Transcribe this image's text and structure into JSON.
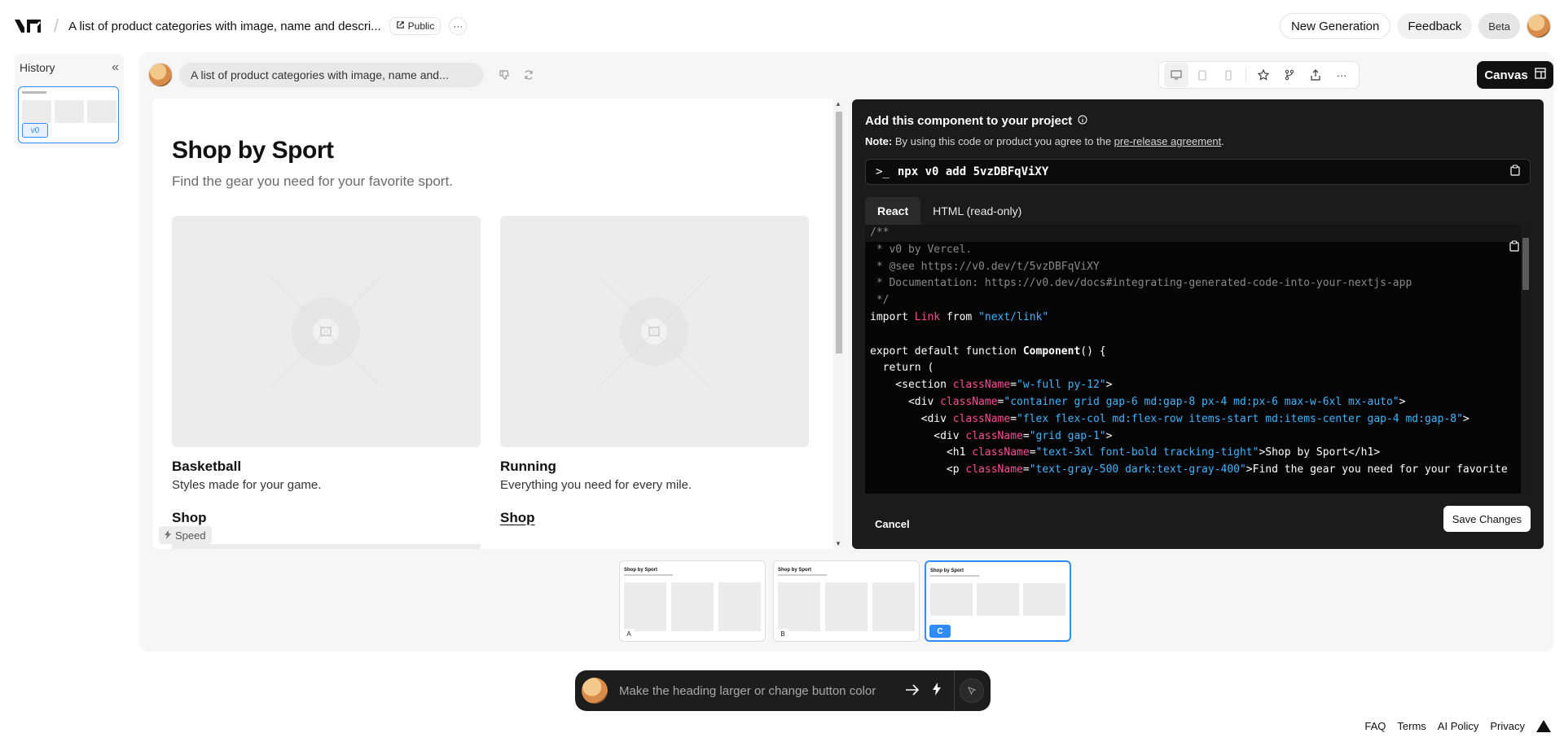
{
  "header": {
    "logo_text": "v0",
    "title": "A list of product categories with image, name and descri...",
    "visibility": "Public",
    "more": "···",
    "new_generation": "New Generation",
    "feedback": "Feedback",
    "beta": "Beta"
  },
  "history": {
    "label": "History",
    "collapse_icon": "«",
    "thumb_badge": "v0"
  },
  "toolbar": {
    "prompt": "A list of product categories with image, name and...",
    "canvas_label": "Canvas"
  },
  "preview": {
    "heading": "Shop by Sport",
    "subheading": "Find the gear you need for your favorite sport.",
    "cards": [
      {
        "title": "Basketball",
        "desc": "Styles made for your game.",
        "link": "Shop"
      },
      {
        "title": "Running",
        "desc": "Everything you need for every mile.",
        "link": "Shop"
      }
    ],
    "speed_tag": "Speed"
  },
  "code_panel": {
    "title": "Add this component to your project",
    "note_label": "Note:",
    "note_text": " By using this code or product you agree to the ",
    "note_link": "pre-release agreement",
    "note_end": ".",
    "command": "npx v0 add 5vzDBFqViXY",
    "prompt_symbol": ">_",
    "tabs": [
      "React",
      "HTML (read-only)"
    ],
    "cancel": "Cancel",
    "save": "Save Changes",
    "code_lines": [
      "/**",
      " * v0 by Vercel.",
      " * @see https://v0.dev/t/5vzDBFqViXY",
      " * Documentation: https://v0.dev/docs#integrating-generated-code-into-your-nextjs-app",
      " */",
      "import Link from \"next/link\"",
      "",
      "export default function Component() {",
      "  return (",
      "    <section className=\"w-full py-12\">",
      "      <div className=\"container grid gap-6 md:gap-8 px-4 md:px-6 max-w-6xl mx-auto\">",
      "        <div className=\"flex flex-col md:flex-row items-start md:items-center gap-4 md:gap-8\">",
      "          <div className=\"grid gap-1\">",
      "            <h1 className=\"text-3xl font-bold tracking-tight\">Shop by Sport</h1>",
      "            <p className=\"text-gray-500 dark:text-gray-400\">Find the gear you need for your favorite"
    ]
  },
  "variants": [
    {
      "badge": "A",
      "title": "Shop by Sport"
    },
    {
      "badge": "B",
      "title": "Shop by Sport"
    },
    {
      "badge": "C",
      "title": "Shop by Sport"
    }
  ],
  "prompt_bar": {
    "placeholder": "Make the heading larger or change button color"
  },
  "footer": {
    "links": [
      "FAQ",
      "Terms",
      "AI Policy",
      "Privacy"
    ]
  },
  "colors": {
    "accent": "#2f8cff",
    "dark_panel": "#1b1b1b",
    "code_pink": "#ff4d94",
    "code_blue": "#3fb6ff"
  }
}
